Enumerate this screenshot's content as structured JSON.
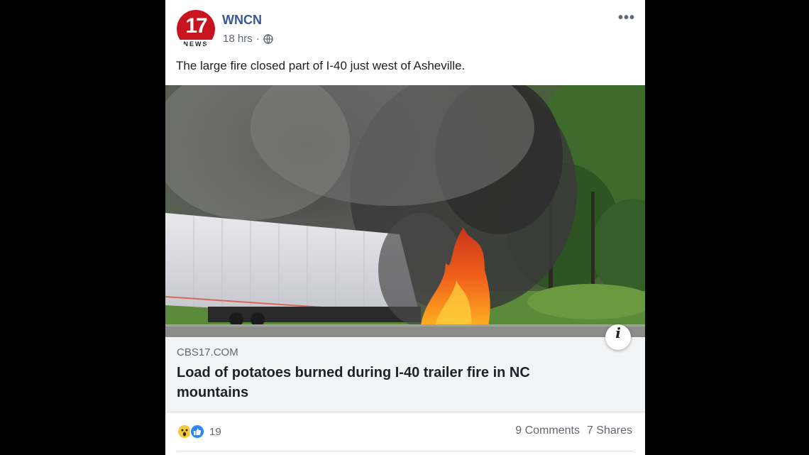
{
  "post": {
    "page_name": "WNCN",
    "avatar_number": "17",
    "avatar_band": "NEWS",
    "time": "18 hrs",
    "separator": "·",
    "privacy_icon": "globe-icon",
    "more_icon": "•••",
    "text": "The large fire closed part of I-40 just west of Asheville."
  },
  "link": {
    "domain": "CBS17.COM",
    "title": "Load of potatoes burned during I-40 trailer fire in NC mountains",
    "info_icon": "i"
  },
  "engagement": {
    "reaction_count": "19",
    "comments": "9 Comments",
    "shares": "7 Shares"
  },
  "colors": {
    "page_name": "#385898",
    "avatar_red": "#c8141e",
    "like_blue": "#2d88ff",
    "wow_yellow": "#f7c93e"
  }
}
